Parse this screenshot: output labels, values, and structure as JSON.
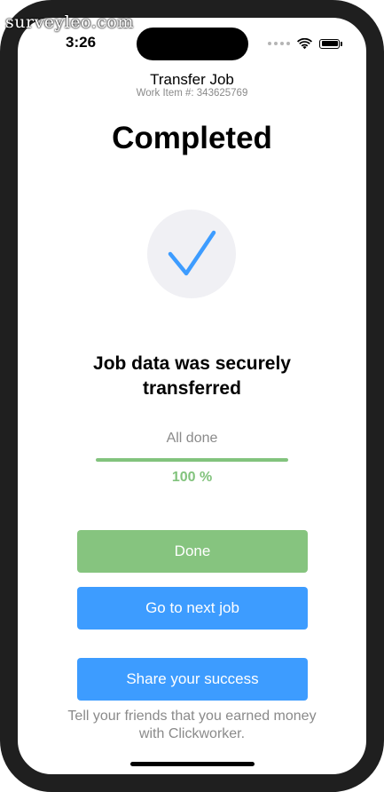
{
  "watermark": "surveyleo.com",
  "status_bar": {
    "time": "3:26",
    "icons": [
      "signal-dots-icon",
      "wifi-icon",
      "battery-icon"
    ]
  },
  "header": {
    "title": "Transfer Job",
    "subtitle": "Work Item #: 343625769"
  },
  "status_title": "Completed",
  "check_icon": "checkmark-icon",
  "colors": {
    "accent_green": "#82c37d",
    "accent_blue": "#3d9cff",
    "check_blue": "#3d9cff"
  },
  "message": "Job data was securely transferred",
  "progress": {
    "label": "All done",
    "value": 100,
    "percent_text": "100 %"
  },
  "buttons": {
    "done": "Done",
    "next_job": "Go to next job",
    "share": "Share your success"
  },
  "share_note": "Tell your friends that you earned money with Clickworker."
}
